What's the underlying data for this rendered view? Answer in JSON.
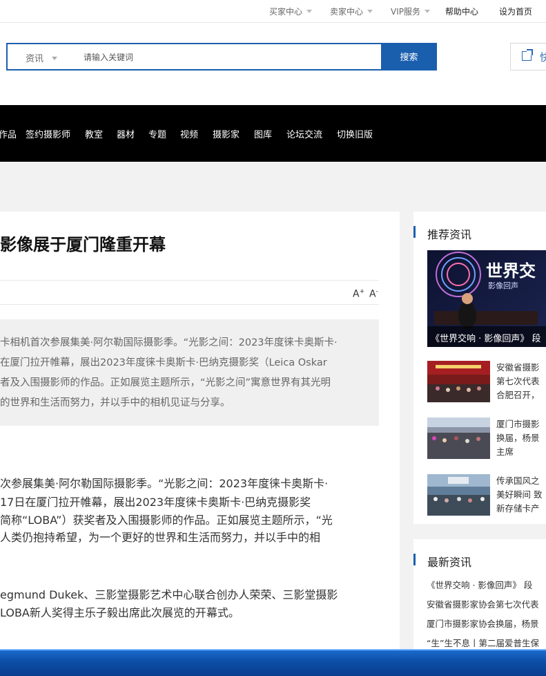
{
  "topbar": {
    "items": [
      {
        "label": "买家中心",
        "dropdown": true
      },
      {
        "label": "卖家中心",
        "dropdown": true
      },
      {
        "label": "VIP服务",
        "dropdown": true
      },
      {
        "label": "帮助中心",
        "dropdown": false
      },
      {
        "label": "设为首页",
        "dropdown": false
      }
    ]
  },
  "search": {
    "category": "资讯",
    "placeholder": "请输入关键词",
    "button": "搜索",
    "quick_label": "快"
  },
  "nav": {
    "items": [
      "作品",
      "签约摄影师",
      "教室",
      "器材",
      "专题",
      "视频",
      "摄影家",
      "图库",
      "论坛交流",
      "切换旧版"
    ]
  },
  "article": {
    "title": "影像展于厦门隆重开幕",
    "font_increase": "A+",
    "font_decrease": "A-",
    "summary_lines": [
      "卡相机首次参展集美·阿尔勒国际摄影季。“光影之间：2023年度徕卡奥斯卡·",
      "在厦门拉开帷幕，展出2023年度徕卡奥斯卡·巴纳克摄影奖（Leica Oskar",
      "者及入围摄影师的作品。正如展览主题所示，“光影之间”寓意世界有其光明",
      "的世界和生活而努力，并以手中的相机见证与分享。"
    ],
    "paragraph1": [
      "次参展集美·阿尔勒国际摄影季。“光影之间：2023年度徕卡奥斯卡·",
      "17日在厦门拉开帷幕，展出2023年度徕卡奥斯卡·巴纳克摄影奖",
      "简称“LOBA”）获奖者及入围摄影师的作品。正如展览主题所示，“光",
      "人类仍抱持希望，为一个更好的世界和生活而努力，并以手中的相"
    ],
    "paragraph2": [
      "egmund Dukek、三影堂摄影艺术中心联合创办人荣荣、三影堂摄影",
      "LOBA新人奖得主乐子毅出席此次展览的开幕式。"
    ]
  },
  "recommended": {
    "heading": "推荐资讯",
    "featured": {
      "caption": "《世界交响 · 影像回声》 段",
      "poster_title": "世界交",
      "poster_subtitle": "影像回声"
    },
    "items": [
      {
        "lines": [
          "安徽省摄影",
          "第七次代表",
          "合肥召开，"
        ]
      },
      {
        "lines": [
          "厦门市摄影",
          "换届，杨景",
          "主席"
        ]
      },
      {
        "lines": [
          "传承国风之",
          "美好瞬间 致",
          "新存储卡产"
        ]
      }
    ]
  },
  "latest": {
    "heading": "最新资讯",
    "items": [
      "《世界交响 · 影像回声》 段",
      "安徽省摄影家协会第七次代表",
      "厦门市摄影家协会换届，杨景",
      "“生”生不息丨第二届爱普生保"
    ]
  },
  "colors": {
    "accent": "#1a5fae",
    "nav_bg": "#000000",
    "taskbar": "#0d4fa8"
  }
}
